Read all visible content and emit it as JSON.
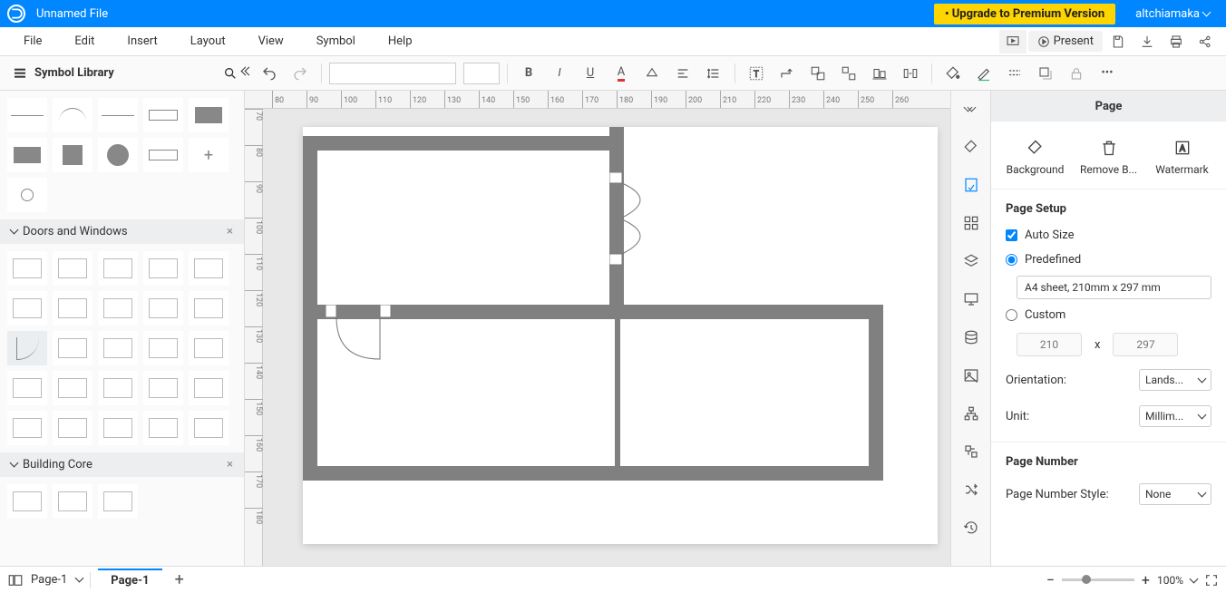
{
  "titlebar": {
    "filename": "Unnamed File",
    "upgrade": "Upgrade to Premium Version",
    "user": "altchiamaka"
  },
  "menu": {
    "file": "File",
    "edit": "Edit",
    "insert": "Insert",
    "layout": "Layout",
    "view": "View",
    "symbol": "Symbol",
    "help": "Help",
    "present": "Present"
  },
  "symlib": {
    "title": "Symbol Library",
    "sections": {
      "doors": "Doors and Windows",
      "core": "Building Core"
    }
  },
  "ruler_top": [
    "80",
    "90",
    "100",
    "110",
    "120",
    "130",
    "140",
    "150",
    "160",
    "170",
    "180",
    "190",
    "200",
    "210",
    "220",
    "230",
    "240",
    "250",
    "260"
  ],
  "ruler_left": [
    "70",
    "80",
    "90",
    "100",
    "110",
    "120",
    "130",
    "140",
    "150",
    "160",
    "170",
    "180"
  ],
  "rpanel": {
    "title": "Page",
    "actions": {
      "background": "Background",
      "remove_bg": "Remove B...",
      "watermark": "Watermark"
    },
    "page_setup": "Page Setup",
    "auto_size": "Auto Size",
    "predefined": "Predefined",
    "predefined_value": "A4 sheet, 210mm x 297 mm",
    "custom": "Custom",
    "custom_w": "210",
    "custom_h": "297",
    "orientation_label": "Orientation:",
    "orientation_value": "Lands...",
    "unit_label": "Unit:",
    "unit_value": "Millim...",
    "page_number": "Page Number",
    "page_number_style_label": "Page Number Style:",
    "page_number_style_value": "None"
  },
  "status": {
    "page_select": "Page-1",
    "page_tab": "Page-1",
    "zoom": "100%"
  }
}
